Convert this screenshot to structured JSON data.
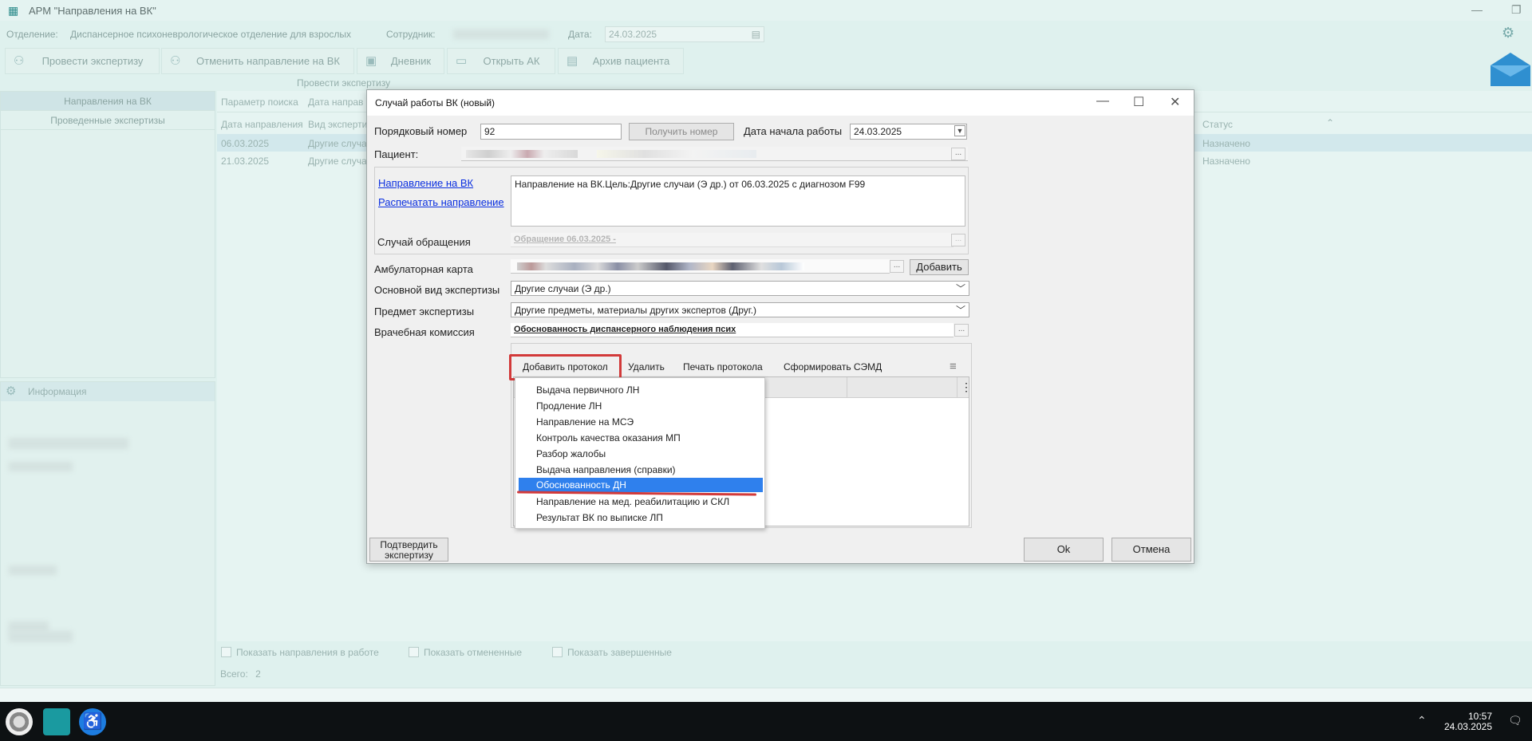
{
  "window": {
    "title": "АРМ \"Направления на ВК\""
  },
  "header": {
    "department_label": "Отделение:",
    "department_value": "Диспансерное психоневрологическое отделение для взрослых",
    "employee_label": "Сотрудник:",
    "date_label": "Дата:",
    "date_value": "24.03.2025"
  },
  "toolbar": {
    "buttons": [
      "Провести экспертизу",
      "Отменить направление на ВК",
      "Дневник",
      "Открыть АК",
      "Архив пациента"
    ],
    "sublabel": "Провести экспертизу"
  },
  "left_panel": {
    "tabs": [
      "Направления на ВК",
      "Проведенные экспертизы"
    ],
    "info_title": "Информация"
  },
  "grid": {
    "search_param_label": "Параметр поиска",
    "headers": [
      "Дата направления",
      "Вид экспертизы",
      "Статус"
    ],
    "search_col2": "Дата направ",
    "rows": [
      {
        "date": "06.03.2025",
        "type": "Другие случа",
        "status": "Назначено"
      },
      {
        "date": "21.03.2025",
        "type": "Другие случа",
        "status": "Назначено"
      }
    ]
  },
  "footer": {
    "checkboxes": [
      "Показать направления в работе",
      "Показать отмененные",
      "Показать завершенные"
    ],
    "total_label": "Всего:",
    "total_value": "2"
  },
  "dialog": {
    "title": "Случай работы ВК (новый)",
    "seq_label": "Порядковый номер",
    "seq_value": "92",
    "get_number": "Получить номер",
    "start_date_label": "Дата начала работы",
    "start_date_value": "24.03.2025",
    "patient_label": "Пациент:",
    "referral_link": "Направление на ВК",
    "print_link": "Распечатать направление",
    "referral_text": "Направление на ВК.Цель:Другие случаи (Э др.) от 06.03.2025 с диагнозом F99",
    "case_label": "Случай обращения",
    "case_value": "Обращение 06.03.2025 -",
    "ambulatory_label": "Амбулаторная карта",
    "add_button": "Добавить",
    "main_type_label": "Основной вид экспертизы",
    "main_type_value": "Другие случаи (Э др.)",
    "subject_label": "Предмет экспертизы",
    "subject_value": "Другие предметы, материалы других экспертов (Друг.)",
    "commission_label": "Врачебная комиссия",
    "commission_value": "Обоснованность диспансерного наблюдения  псих",
    "protocol_toolbar": [
      "Добавить протокол",
      "Удалить",
      "Печать протокола",
      "Сформировать СЭМД"
    ],
    "confirm_button": "Подтвердить экспертизу",
    "ok_button": "Ok",
    "cancel_button": "Отмена"
  },
  "protocol_menu": {
    "items": [
      "Выдача первичного ЛН",
      "Продление ЛН",
      "Направление на МСЭ",
      "Контроль качества оказания МП",
      "Разбор жалобы",
      "Выдача направления (справки)",
      "Обоснованность ДН",
      "Направление на мед. реабилитацию и СКЛ",
      "Результат ВК по выписке ЛП"
    ],
    "selected": "Обоснованность ДН"
  },
  "taskbar": {
    "time": "10:57",
    "date": "24.03.2025"
  },
  "colors": {
    "accent": "#2f80ed",
    "highlight": "#d23a3a",
    "link": "#0a2fe0"
  }
}
